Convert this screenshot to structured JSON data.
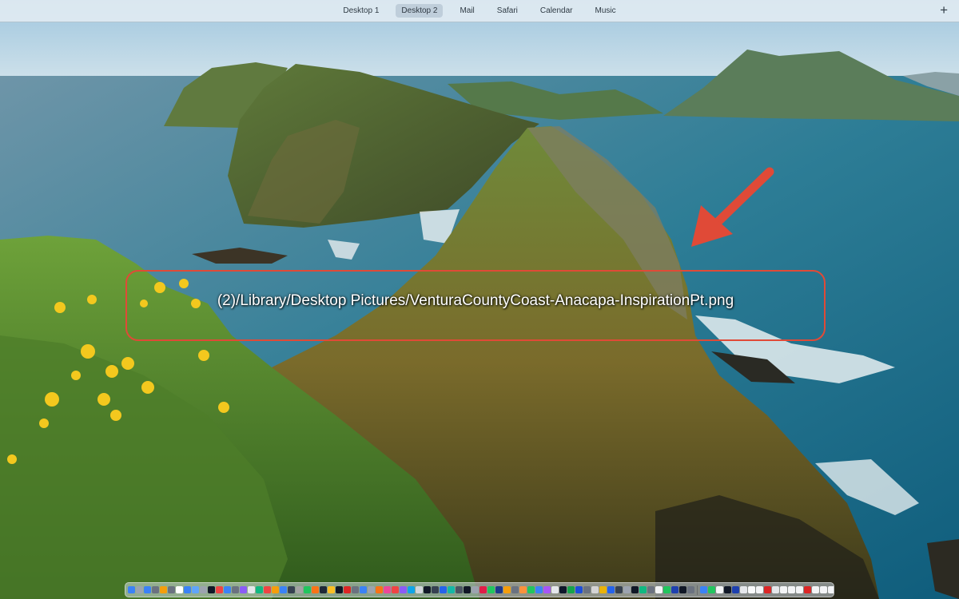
{
  "spaces_bar": {
    "tabs": [
      {
        "label": "Desktop 1",
        "active": false
      },
      {
        "label": "Desktop 2",
        "active": true
      },
      {
        "label": "Mail",
        "active": false
      },
      {
        "label": "Safari",
        "active": false
      },
      {
        "label": "Calendar",
        "active": false
      },
      {
        "label": "Music",
        "active": false
      }
    ],
    "add_label": "+"
  },
  "annotation": {
    "path_text": "(2)/Library/Desktop Pictures/VenturaCountyCoast-Anacapa-InspirationPt.png",
    "color": "#e04a37"
  },
  "dock": {
    "left_icons": [
      "#3b82f6",
      "#9ca3af",
      "#3b82f6",
      "#6b7280",
      "#f59e0b",
      "#6b7280",
      "#ffffff",
      "#3b82f6",
      "#60a5fa",
      "#9ca3af",
      "#111827",
      "#ef4444",
      "#3b82f6",
      "#6b7280",
      "#8b5cf6",
      "#e5e7eb",
      "#10b981",
      "#ef4444",
      "#f59e0b",
      "#3b82f6",
      "#374151",
      "#a3a3a3",
      "#22c55e",
      "#f97316",
      "#1f2937",
      "#fbbf24",
      "#111827",
      "#dc2626",
      "#6b7280",
      "#3b82f6",
      "#9ca3af",
      "#f97316",
      "#ec4899",
      "#ef4444",
      "#8b5cf6",
      "#0ea5e9",
      "#d1d5db",
      "#111827",
      "#374151",
      "#2563eb",
      "#14b8a6",
      "#4b5563",
      "#111827",
      "#9ca3af",
      "#e11d48",
      "#22c55e",
      "#1e3a8a",
      "#f59e0b",
      "#6b7280",
      "#fb923c",
      "#22c55e",
      "#3b82f6",
      "#a855f7",
      "#e5e7eb",
      "#0f172a",
      "#16a34a",
      "#1d4ed8",
      "#6b7280",
      "#d4d4d4",
      "#eab308",
      "#2563eb",
      "#374151",
      "#9ca3af",
      "#111827",
      "#10b981",
      "#6b7280",
      "#f3f4f6",
      "#22c55e",
      "#1e40af",
      "#111827",
      "#6b7280"
    ],
    "right_icons": [
      "#3b82f6",
      "#22c55e",
      "#f3f4f6",
      "#111827",
      "#1e40af",
      "#e5e7eb",
      "#f9fafb",
      "#f3f4f6",
      "#dc2626",
      "#e5e7eb",
      "#f3f4f6",
      "#f3f4f6",
      "#f3f4f6",
      "#dc2626",
      "#f3f4f6",
      "#f3f4f6",
      "#f3f4f6",
      "#7c3aed",
      "#f3f4f6",
      "#f3f4f6",
      "#6b7280",
      "#6b7280"
    ]
  }
}
